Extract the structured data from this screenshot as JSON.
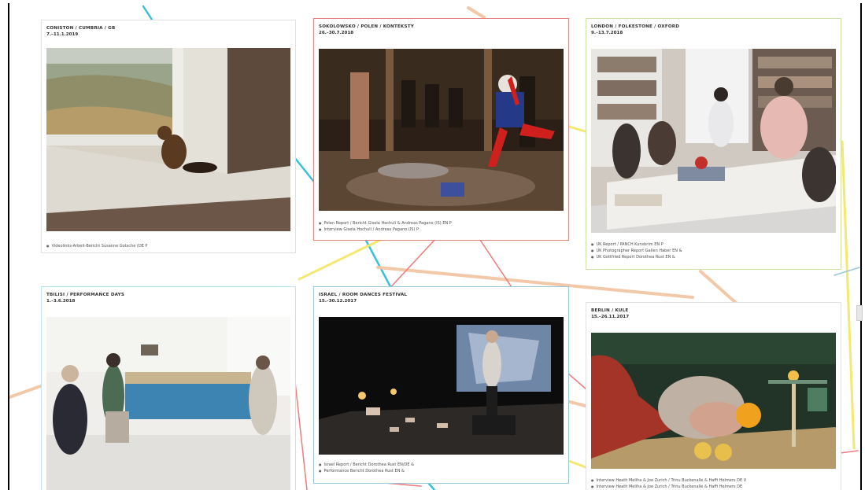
{
  "colors": {
    "page_bg": "#ffffff",
    "card_border": "#e1e1e1",
    "red_border": "#e5847c",
    "green_border": "#cde0a5",
    "blue_border": "#9ac7da",
    "teal_line": "#38c2d7",
    "yellow_line": "#f5e86e",
    "peach_line": "#f3c8a9",
    "red_line": "#ef7b7b"
  },
  "cards": [
    {
      "id": "coniston",
      "title": "CONISTON / CUMBRIA / GB",
      "date": "7.–11.1.2019",
      "links": [
        "Videolinks-Arbeit-Bericht Susanne Gotsche (DE P"
      ]
    },
    {
      "id": "sokolowsko",
      "title": "SOKOLOWSKO / POLEN / KONTEKSTY",
      "date": "26.–30.7.2018",
      "links": [
        "Polen Report / Bericht Gisela Hochuli & Andreas Pagano (IS) EN P",
        "Interview Gisela Hochuli / Andreas Pagano (IS) P"
      ]
    },
    {
      "id": "london",
      "title": "LONDON / FOLKESTONE / OXFORD",
      "date": "9.–13.7.2018",
      "links": [
        "UK Report / PANCH Kunsbrim EN P",
        "UK Photographer Report Gallen Haber EN &",
        "UK Gottfried Report Dorothea Rust EN &"
      ]
    },
    {
      "id": "tbilisi",
      "title": "TBILISI / PERFORMANCE DAYS",
      "date": "1.–3.6.2018",
      "links": []
    },
    {
      "id": "israel",
      "title": "ISRAEL / ROOM DANCES FESTIVAL",
      "date": "15.–30.12.2017",
      "links": [
        "Israel Report / Bericht Dorothea Rust EN/DE &",
        "Performance Bericht Dorothea Rust EN &"
      ]
    },
    {
      "id": "berlin",
      "title": "BERLIN / KULE",
      "date": "15.–26.11.2017",
      "links": [
        "Interview Heath Meliha & Joe Zurich / Trinu Buckenalle & Haffi Helmers DE V",
        "Interview Heath Meliha & Joe Zurich / Trinu Buckenalle & Haffi Helmers DE"
      ]
    }
  ]
}
